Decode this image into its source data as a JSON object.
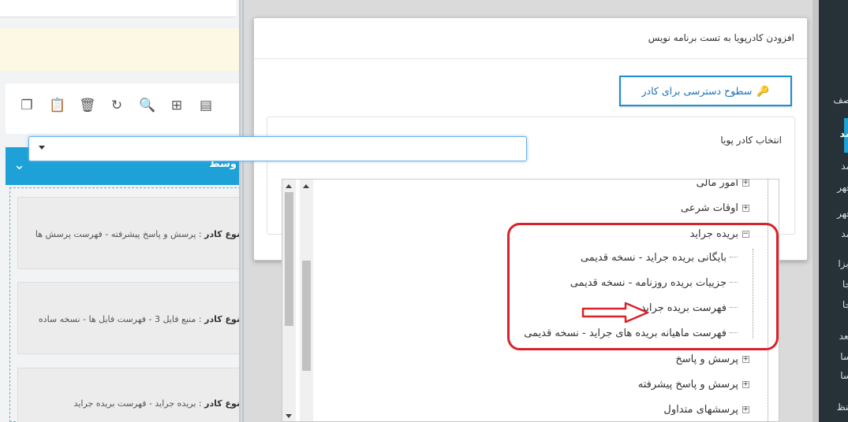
{
  "background": {
    "panel_title": "وسط",
    "cards": [
      {
        "key": "نوع کادر",
        "value": " : پرسش و پاسخ پیشرفته - فهرست پرسش ها"
      },
      {
        "key": "نوع کادر",
        "value": " : منبع فایل 3 - فهرست فایل ها - نسخه ساده"
      },
      {
        "key": "نوع کادر",
        "value": " : بریده جراید - فهرست بریده جراید"
      }
    ],
    "sidebar_items": [
      "صف",
      "مد",
      "مد",
      "فهر",
      "فهر",
      "مد",
      "ابزا",
      "جا",
      "جا",
      "تعد",
      "سا",
      "سا",
      "تنظ"
    ]
  },
  "modal": {
    "title": "افزودن کادرپویا به تست برنامه نویس",
    "access_button_label": "سطوح دسترسی برای کادر",
    "select_label": "انتخاب کادر پویا"
  },
  "tree": {
    "top_items": [
      {
        "label": "امور مالی"
      },
      {
        "label": "اوقات شرعی"
      },
      {
        "label": "بریده جراید"
      }
    ],
    "children": [
      {
        "label": "بایگانی بریده جراید - نسخه قدیمی"
      },
      {
        "label": "جزییات بریده روزنامه - نسخه قدیمی"
      },
      {
        "label": "فهرست بریده جراید"
      },
      {
        "label": "فهرست ماهیانه بریده های جراید - نسخه قدیمی"
      }
    ],
    "bottom_items": [
      {
        "label": "پرسش و پاسخ"
      },
      {
        "label": "پرسش و پاسخ پیشرفته"
      },
      {
        "label": "پرسشهای متداول"
      }
    ]
  },
  "colors": {
    "accent": "#1da1d6",
    "highlight": "#d7232a",
    "sidebar_dark": "#263238"
  }
}
